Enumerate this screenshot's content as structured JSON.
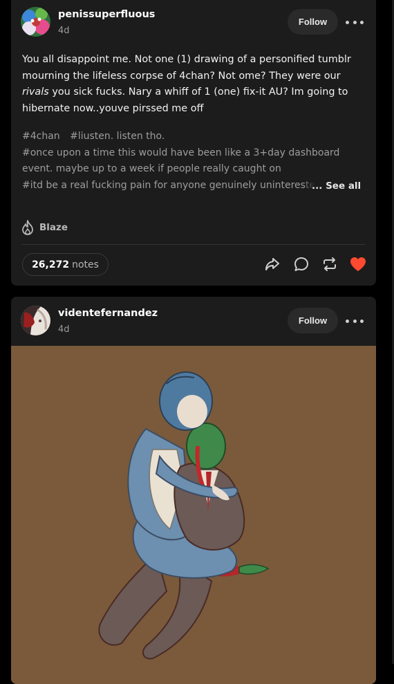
{
  "colors": {
    "card_bg": "#1c1c1c",
    "page_bg": "#000000",
    "like_red": "#ff4930",
    "artwork_bg": "#7a5a3a",
    "tag_gray": "#9d9d9d"
  },
  "post1": {
    "username": "penissuperfluous",
    "age": "4d",
    "follow_label": "Follow",
    "more_icon": "ellipsis-icon",
    "body": {
      "part1": "You all disappoint me. Not one (1) drawing of a personified tumblr mourning the lifeless corpse of 4chan? Not ome? They were our ",
      "italic": "rivals",
      "part2": " you sick fucks. Nary a whiff of 1 (one) fix-it AU? Im going to hibernate now..youve pirssed me off"
    },
    "tags": [
      "#4chan",
      "#liusten. listen tho.",
      "#once upon a time this would have been like a 3+day dashboard event. maybe up to a week if people really caught on",
      "#itd be a real fucking pain for anyone genuinely uninterested"
    ],
    "see_all_label": "... See all",
    "blaze_label": "Blaze",
    "notes_count": "26,272",
    "notes_label": "notes",
    "liked": true
  },
  "post2": {
    "username": "videntefernandez",
    "age": "4d",
    "follow_label": "Follow",
    "more_icon": "ellipsis-icon",
    "image_subject": "illustration-artwork"
  }
}
